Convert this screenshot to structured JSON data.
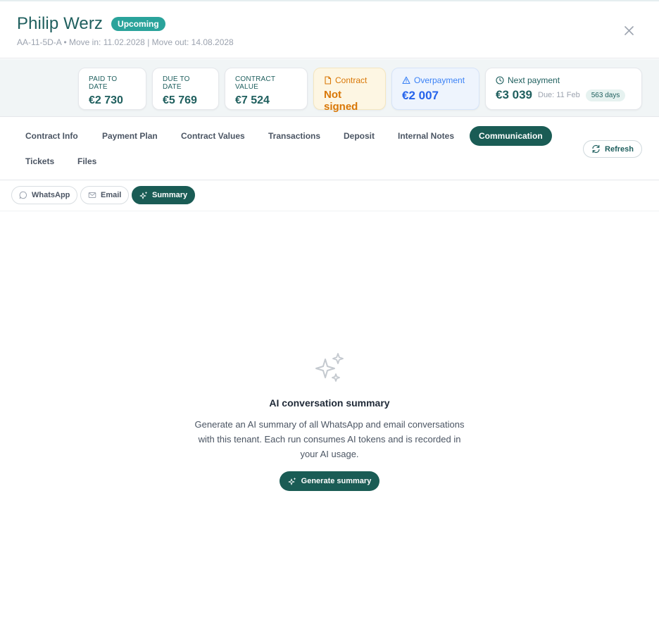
{
  "header": {
    "tenant_name": "Philip Werz",
    "status": "Upcoming",
    "subline": "AA-11-5D-A • Move in: 11.02.2028 | Move out: 14.08.2028"
  },
  "kpis": {
    "paid_label": "PAID TO DATE",
    "paid_value": "€2 730",
    "due_label": "DUE TO DATE",
    "due_value": "€5 769",
    "contract_value_label": "CONTRACT VALUE",
    "contract_value": "€7 524",
    "contract_label": "Contract",
    "contract_status": "Not signed",
    "overpayment_label": "Overpayment",
    "overpayment_value": "€2 007",
    "next_payment_label": "Next payment",
    "next_payment_value": "€3 039",
    "next_payment_due": "Due: 11 Feb",
    "next_payment_days": "563 days"
  },
  "tabs": [
    {
      "label": "Contract Info"
    },
    {
      "label": "Payment Plan"
    },
    {
      "label": "Contract Values"
    },
    {
      "label": "Transactions"
    },
    {
      "label": "Deposit"
    },
    {
      "label": "Internal Notes"
    },
    {
      "label": "Communication"
    },
    {
      "label": "Tickets"
    },
    {
      "label": "Files"
    }
  ],
  "active_tab": "Communication",
  "refresh_label": "Refresh",
  "subtabs": [
    {
      "label": "WhatsApp",
      "icon": "whatsapp-icon"
    },
    {
      "label": "Email",
      "icon": "mail-icon"
    },
    {
      "label": "Summary",
      "icon": "sparkles-icon"
    }
  ],
  "active_subtab": "Summary",
  "empty_state": {
    "title": "AI conversation summary",
    "description": "Generate an AI summary of all WhatsApp and email conversations with this tenant. Each run consumes AI tokens and is recorded in your AI usage.",
    "button_label": "Generate summary"
  },
  "colors": {
    "accent": "#1a5c55",
    "status_badge": "#2aa39b",
    "warning": "#d97706",
    "info": "#2563eb"
  }
}
